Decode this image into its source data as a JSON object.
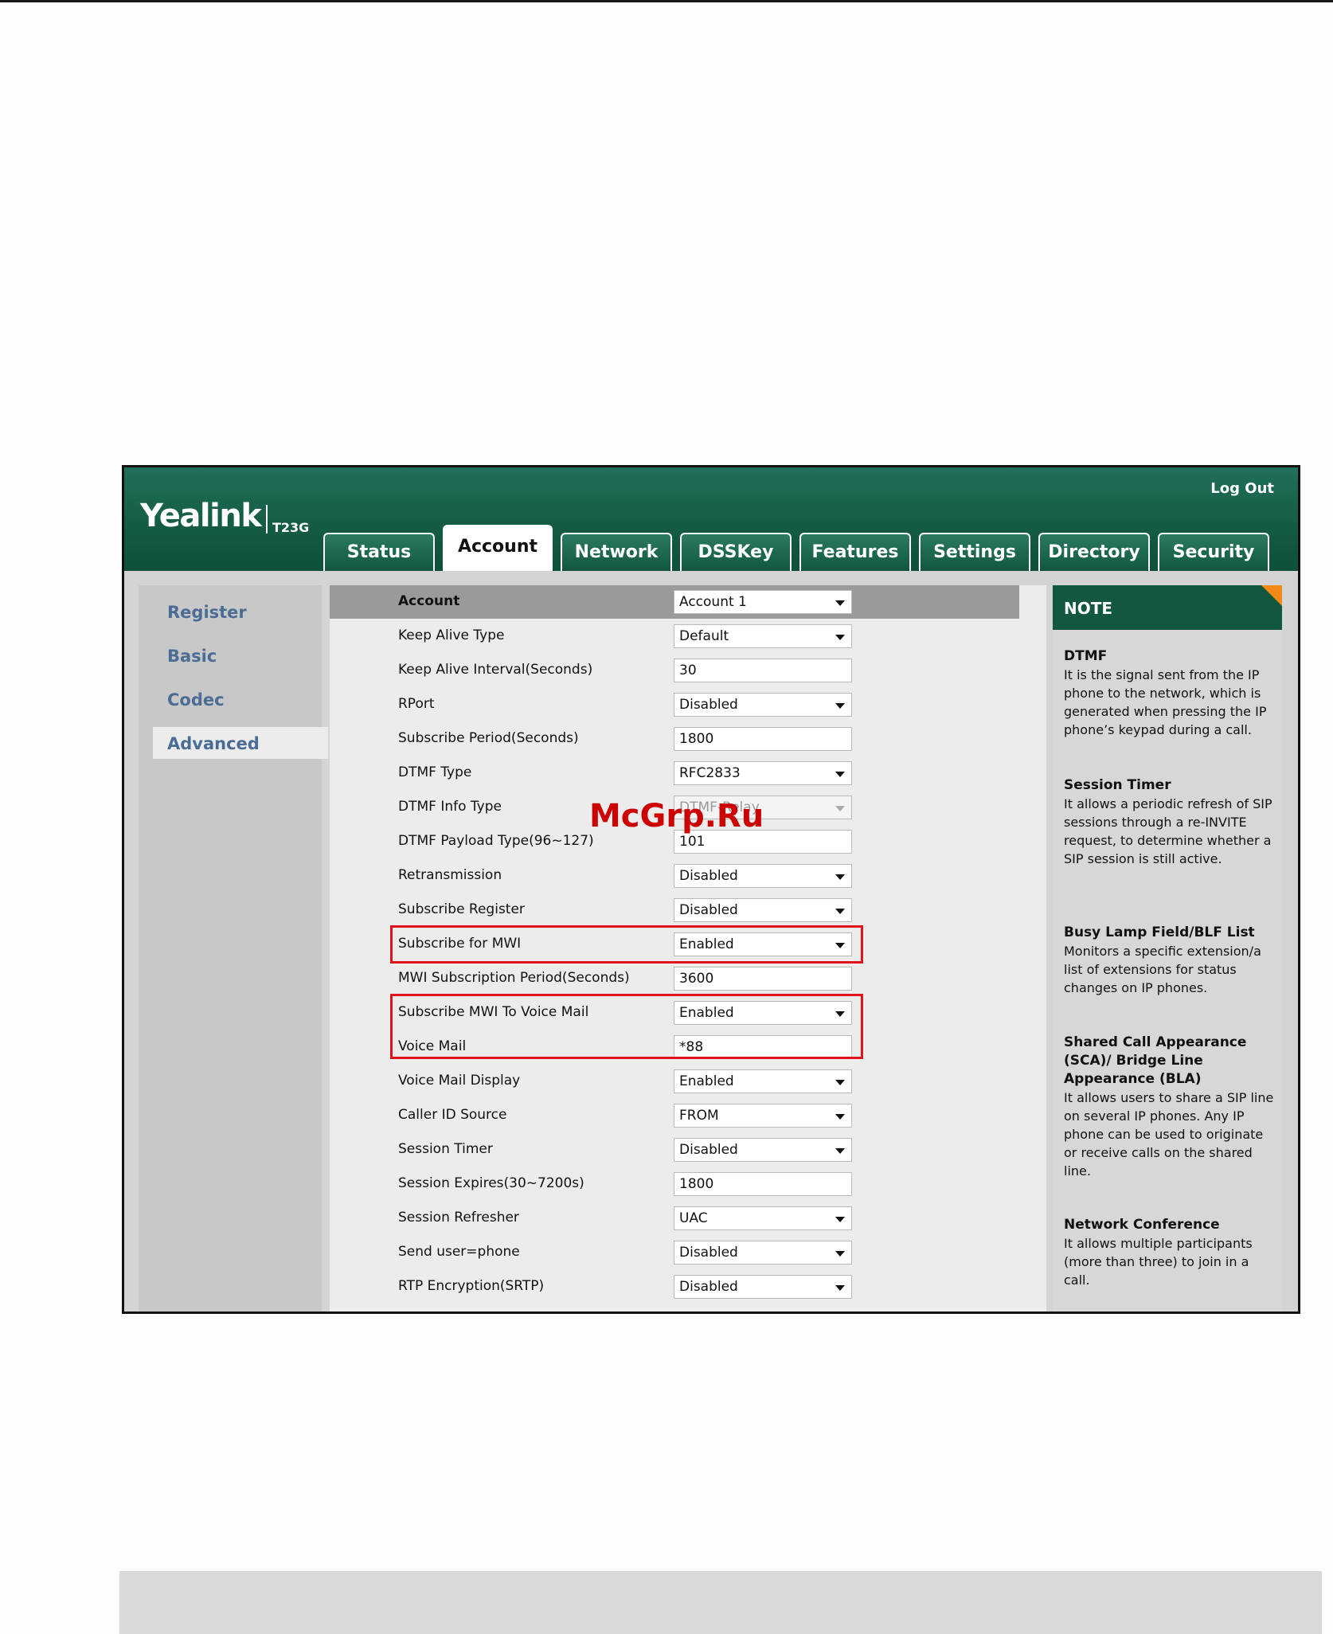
{
  "header": {
    "logo": "Yealink",
    "model": "T23G",
    "logout": "Log Out"
  },
  "tabs": [
    {
      "label": "Status"
    },
    {
      "label": "Account"
    },
    {
      "label": "Network"
    },
    {
      "label": "DSSKey"
    },
    {
      "label": "Features"
    },
    {
      "label": "Settings"
    },
    {
      "label": "Directory"
    },
    {
      "label": "Security"
    }
  ],
  "sidebar": {
    "items": [
      {
        "label": "Register"
      },
      {
        "label": "Basic"
      },
      {
        "label": "Codec"
      },
      {
        "label": "Advanced"
      }
    ]
  },
  "form": {
    "rows": [
      {
        "label": "Account",
        "value": "Account 1"
      },
      {
        "label": "Keep Alive Type",
        "value": "Default"
      },
      {
        "label": "Keep Alive Interval(Seconds)",
        "value": "30"
      },
      {
        "label": "RPort",
        "value": "Disabled"
      },
      {
        "label": "Subscribe Period(Seconds)",
        "value": "1800"
      },
      {
        "label": "DTMF Type",
        "value": "RFC2833"
      },
      {
        "label": "DTMF Info Type",
        "value": "DTMF-Relay"
      },
      {
        "label": "DTMF Payload Type(96~127)",
        "value": "101"
      },
      {
        "label": "Retransmission",
        "value": "Disabled"
      },
      {
        "label": "Subscribe Register",
        "value": "Disabled"
      },
      {
        "label": "Subscribe for MWI",
        "value": "Enabled"
      },
      {
        "label": "MWI Subscription Period(Seconds)",
        "value": "3600"
      },
      {
        "label": "Subscribe MWI To Voice Mail",
        "value": "Enabled"
      },
      {
        "label": "Voice Mail",
        "value": "*88"
      },
      {
        "label": "Voice Mail Display",
        "value": "Enabled"
      },
      {
        "label": "Caller ID Source",
        "value": "FROM"
      },
      {
        "label": "Session Timer",
        "value": "Disabled"
      },
      {
        "label": "Session Expires(30~7200s)",
        "value": "1800"
      },
      {
        "label": "Session Refresher",
        "value": "UAC"
      },
      {
        "label": "Send user=phone",
        "value": "Disabled"
      },
      {
        "label": "RTP Encryption(SRTP)",
        "value": "Disabled"
      }
    ]
  },
  "note": {
    "title": "NOTE",
    "sections": [
      {
        "heading": "DTMF",
        "text": "It is the signal sent from the IP phone to the network, which is generated when pressing the IP phone’s keypad during a call."
      },
      {
        "heading": "Session Timer",
        "text": "It allows a periodic refresh of SIP sessions through a re-INVITE request, to determine whether a SIP session is still active."
      },
      {
        "heading": "Busy Lamp Field/BLF List",
        "text": "Monitors a specific extension/a list of extensions for status changes on IP phones."
      },
      {
        "heading": "Shared Call Appearance (SCA)/ Bridge Line Appearance (BLA)",
        "text": "It allows users to share a SIP line on several IP phones. Any IP phone can be used to originate or receive calls on the shared line."
      },
      {
        "heading": "Network Conference",
        "text": "It allows multiple participants (more than three) to join in a call."
      }
    ]
  },
  "watermark": "McGrp.Ru",
  "colors": {
    "header_green": "#155c45",
    "sidebar_link": "#4b6c94",
    "highlight_red": "#e0141e",
    "note_corner": "#f28a1a"
  }
}
